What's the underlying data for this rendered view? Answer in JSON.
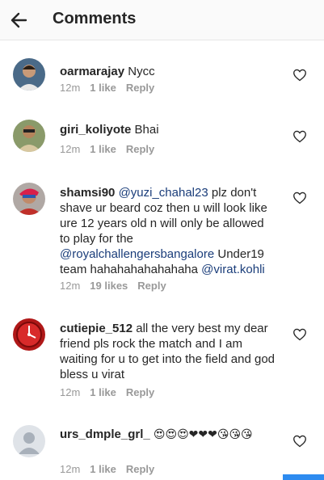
{
  "header": {
    "title": "Comments"
  },
  "comments": [
    {
      "username": "oarmarajay",
      "text": "Nycc",
      "time": "12m",
      "likes": "1 like",
      "reply": "Reply"
    },
    {
      "username": "giri_koliyote",
      "text": "Bhai",
      "time": "12m",
      "likes": "1 like",
      "reply": "Reply"
    },
    {
      "username": "shamsi90",
      "mention1": "@yuzi_chahal23",
      "text1": " plz don't shave ur beard coz then u will look like ure 12 years old n will only be allowed to play for the ",
      "mention2": "@royalchallengersbangalore",
      "text2": " Under19 team hahahahahahahaha ",
      "mention3": "@virat.kohli",
      "time": "12m",
      "likes": "19 likes",
      "reply": "Reply"
    },
    {
      "username": "cutiepie_512",
      "text": "all the very best my dear friend pls rock the match and I am waiting for u to get into the field and god bless u virat",
      "time": "12m",
      "likes": "1 like",
      "reply": "Reply"
    },
    {
      "username": "urs_dmple_grl_",
      "text": "😍😍😍❤❤❤😘😘😘",
      "time": "12m",
      "likes": "1 like",
      "reply": "Reply"
    }
  ],
  "colors": {
    "mention": "#1a3d7a",
    "meta": "#999999",
    "accent": "#2d8bf0"
  }
}
